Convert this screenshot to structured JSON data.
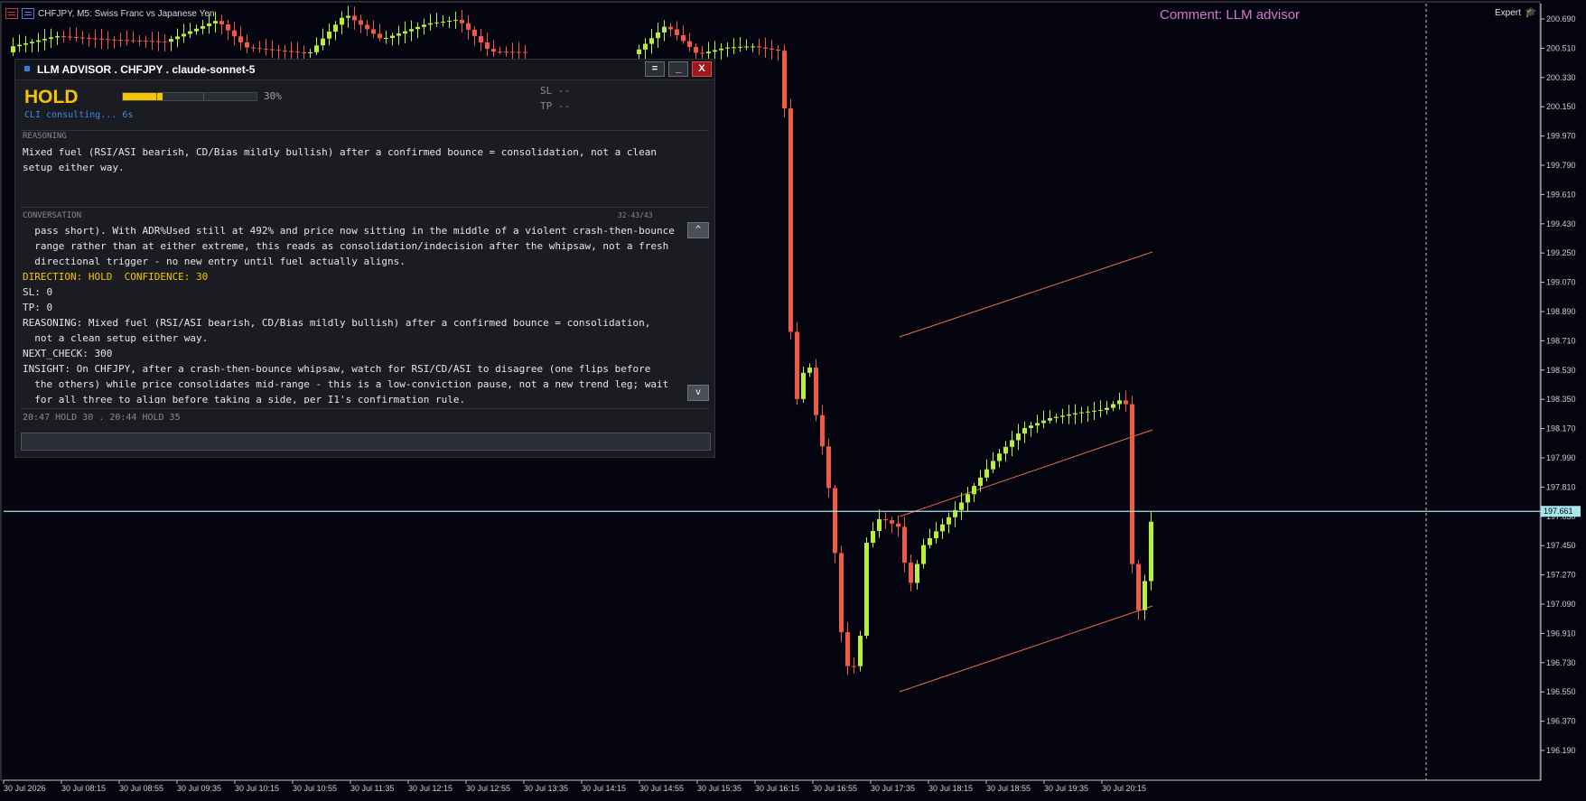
{
  "chart": {
    "title": "CHFJPY, M5:  Swiss Franc vs Japanese Yen",
    "comment": "Comment: LLM advisor",
    "expert_label": "Expert",
    "current_price": "197.661",
    "price_axis_labels": [
      "200.690",
      "200.510",
      "200.330",
      "200.150",
      "199.970",
      "199.790",
      "199.610",
      "199.430",
      "199.250",
      "199.070",
      "198.890",
      "198.710",
      "198.530",
      "198.350",
      "198.170",
      "197.990",
      "197.810",
      "197.630",
      "197.450",
      "197.270",
      "197.090",
      "196.910",
      "196.730",
      "196.550",
      "196.370",
      "196.190"
    ],
    "time_axis_labels": [
      "30 Jul 2026",
      "30 Jul 08:15",
      "30 Jul 08:55",
      "30 Jul 09:35",
      "30 Jul 10:15",
      "30 Jul 10:55",
      "30 Jul 11:35",
      "30 Jul 12:15",
      "30 Jul 12:55",
      "30 Jul 13:35",
      "30 Jul 14:15",
      "30 Jul 14:55",
      "30 Jul 15:35",
      "30 Jul 16:15",
      "30 Jul 16:55",
      "30 Jul 17:35",
      "30 Jul 18:15",
      "30 Jul 18:55",
      "30 Jul 19:35",
      "30 Jul 20:15"
    ],
    "colors": {
      "background": "#03040f",
      "bull": "#b6f03a",
      "bear": "#f05a45",
      "price_line": "#a8e6ec",
      "channel": "#f06a4a"
    }
  },
  "panel": {
    "title": "LLM ADVISOR . CHFJPY . claude-sonnet-5",
    "buttons": {
      "menu": "=",
      "minimize": "_",
      "close": "X"
    },
    "signal": "HOLD",
    "confidence_percent": 30,
    "confidence_label": "30%",
    "cli_status": "CLI consulting... 6s",
    "sl": "SL --",
    "tp": "TP --",
    "reasoning_label": "REASONING",
    "reasoning_text": "Mixed fuel (RSI/ASI bearish, CD/Bias mildly bullish) after a confirmed bounce = consolidation, not a clean\nsetup either way.",
    "conversation_label": "CONVERSATION",
    "conversation_count": "32-43/43",
    "conversation_lines": [
      {
        "text": "  pass short). With ADR%Used still at 492% and price now sitting in the middle of a violent crash-then-bounce",
        "hl": false
      },
      {
        "text": "  range rather than at either extreme, this reads as consolidation/indecision after the whipsaw, not a fresh",
        "hl": false
      },
      {
        "text": "  directional trigger - no new entry until fuel actually aligns.",
        "hl": false
      },
      {
        "text": "DIRECTION: HOLD  CONFIDENCE: 30",
        "hl": true
      },
      {
        "text": "SL: 0",
        "hl": false
      },
      {
        "text": "TP: 0",
        "hl": false
      },
      {
        "text": "REASONING: Mixed fuel (RSI/ASI bearish, CD/Bias mildly bullish) after a confirmed bounce = consolidation,",
        "hl": false
      },
      {
        "text": "  not a clean setup either way.",
        "hl": false
      },
      {
        "text": "NEXT_CHECK: 300",
        "hl": false
      },
      {
        "text": "INSIGHT: On CHFJPY, after a crash-then-bounce whipsaw, watch for RSI/CD/ASI to disagree (one flips before",
        "hl": false
      },
      {
        "text": "  the others) while price consolidates mid-range - this is a low-conviction pause, not a new trend leg; wait",
        "hl": false
      },
      {
        "text": "  for all three to align before taking a side, per I1's confirmation rule.",
        "hl": false
      }
    ],
    "scroll_up": "^",
    "scroll_down": "v",
    "history": "20:47 HOLD 30  .  20:44 HOLD 35",
    "input_value": ""
  }
}
